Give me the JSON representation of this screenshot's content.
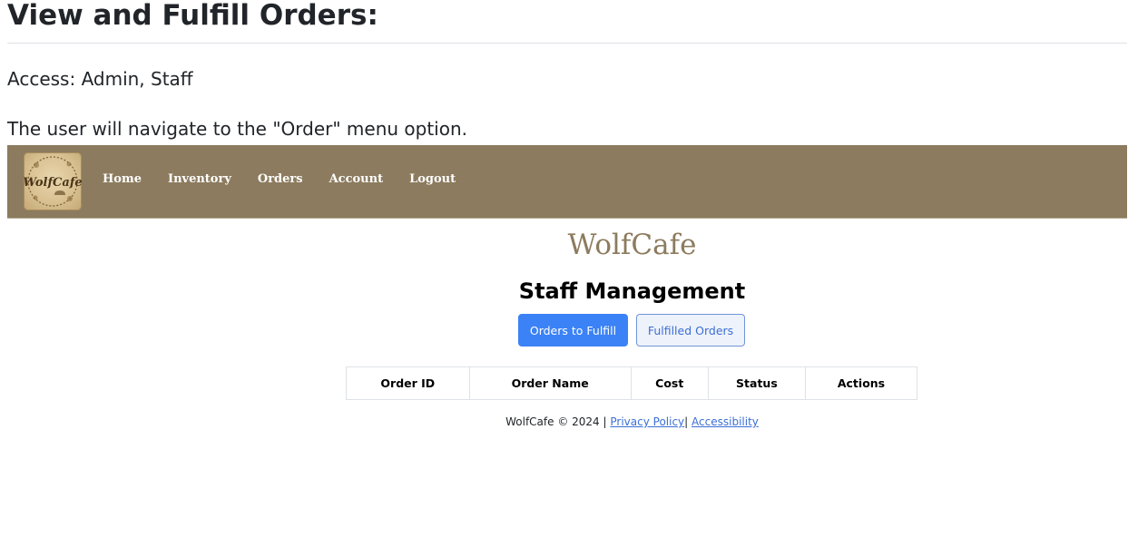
{
  "document": {
    "title": "View and Fulfill Orders:",
    "access": "Access: Admin, Staff",
    "instruction": "The user will navigate to the \"Order\" menu option."
  },
  "app": {
    "logo_text": "WolfCafe",
    "nav": {
      "items": [
        {
          "label": "Home"
        },
        {
          "label": "Inventory"
        },
        {
          "label": "Orders"
        },
        {
          "label": "Account"
        },
        {
          "label": "Logout"
        }
      ]
    },
    "brand": "WolfCafe",
    "section_title": "Staff Management",
    "buttons": {
      "orders_to_fulfill": "Orders to Fulfill",
      "fulfilled_orders": "Fulfilled Orders"
    },
    "table": {
      "columns": [
        "Order ID",
        "Order Name",
        "Cost",
        "Status",
        "Actions"
      ],
      "rows": []
    },
    "footer": {
      "copyright": "WolfCafe © 2024 |",
      "privacy": "Privacy Policy",
      "separator": "|",
      "accessibility": "Accessibility"
    },
    "colors": {
      "navbar": "#8c7b5e",
      "brand": "#8c7b5e",
      "primary_button": "#3b82f6",
      "link": "#3b6fd6"
    }
  }
}
